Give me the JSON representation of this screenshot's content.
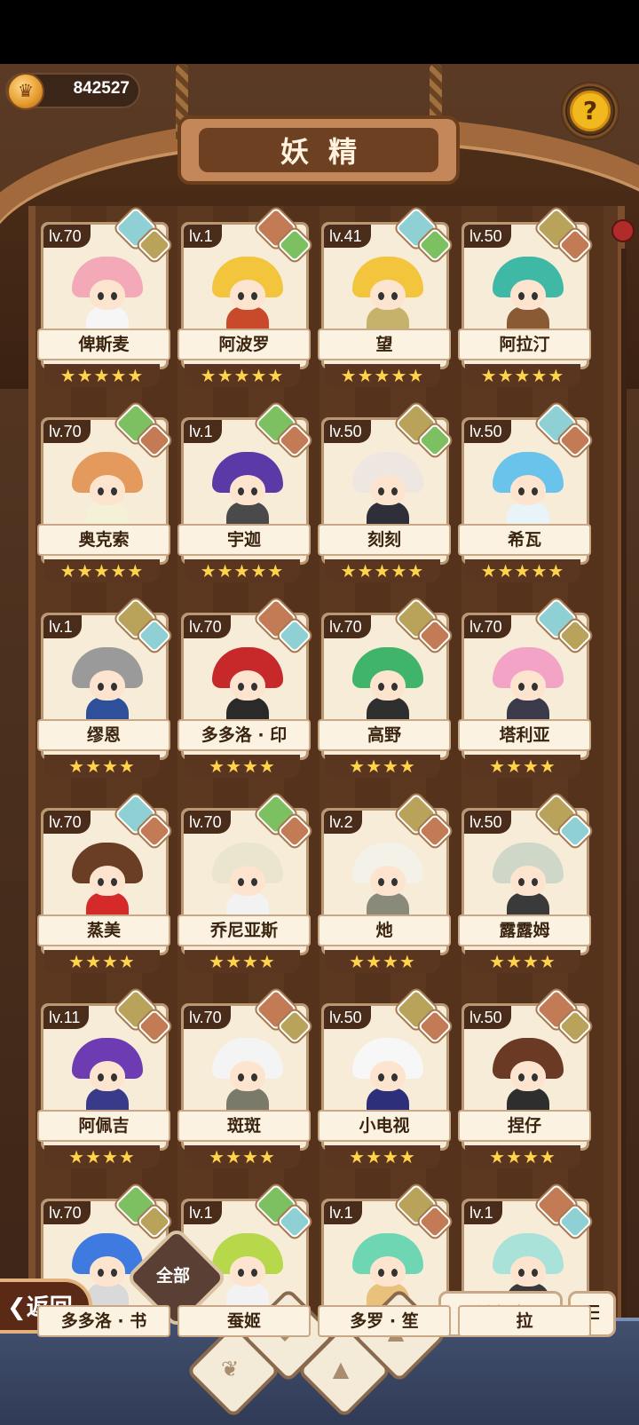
{
  "currency": {
    "icon": "crown-coin-icon",
    "value": "842527"
  },
  "help": {
    "icon": "question-bulb-icon",
    "label": "?"
  },
  "title": "妖精",
  "fairies": [
    {
      "level": "lv.70",
      "name": "俾斯麦",
      "stars": "★★★★★",
      "badges": [
        "water",
        "earth"
      ],
      "hair": "#f3a9b8",
      "outfit": "#f6f6f6"
    },
    {
      "level": "lv.1",
      "name": "阿波罗",
      "stars": "★★★★★",
      "badges": [
        "rock",
        "plant"
      ],
      "hair": "#f2c53d",
      "outfit": "#c94a2a"
    },
    {
      "level": "lv.41",
      "name": "望",
      "stars": "★★★★★",
      "badges": [
        "water",
        "plant"
      ],
      "hair": "#f2c53d",
      "outfit": "#c6b26a"
    },
    {
      "level": "lv.50",
      "name": "阿拉汀",
      "stars": "★★★★★",
      "badges": [
        "earth",
        "rock"
      ],
      "hair": "#3fb8a6",
      "outfit": "#8a5a34"
    },
    {
      "level": "lv.70",
      "name": "奥克索",
      "stars": "★★★★★",
      "badges": [
        "plant",
        "rock"
      ],
      "hair": "#e39a5c",
      "outfit": "#f4f1d8"
    },
    {
      "level": "lv.1",
      "name": "宇迦",
      "stars": "★★★★★",
      "badges": [
        "plant",
        "rock"
      ],
      "hair": "#5b3aa8",
      "outfit": "#4a4a4a"
    },
    {
      "level": "lv.50",
      "name": "刻刻",
      "stars": "★★★★★",
      "badges": [
        "earth",
        "plant"
      ],
      "hair": "#eee6e0",
      "outfit": "#2f2f3a"
    },
    {
      "level": "lv.50",
      "name": "希瓦",
      "stars": "★★★★★",
      "badges": [
        "water",
        "rock"
      ],
      "hair": "#69c3ea",
      "outfit": "#e8f4f8"
    },
    {
      "level": "lv.1",
      "name": "缪恩",
      "stars": "★★★★",
      "badges": [
        "earth",
        "water"
      ],
      "hair": "#9a9a9a",
      "outfit": "#2e4f9a"
    },
    {
      "level": "lv.70",
      "name": "多多洛 · 印",
      "stars": "★★★★",
      "badges": [
        "rock",
        "water"
      ],
      "hair": "#c7282a",
      "outfit": "#2a2a2a"
    },
    {
      "level": "lv.70",
      "name": "高野",
      "stars": "★★★★",
      "badges": [
        "earth",
        "rock"
      ],
      "hair": "#3fb46a",
      "outfit": "#2f2f2f"
    },
    {
      "level": "lv.70",
      "name": "塔利亚",
      "stars": "★★★★",
      "badges": [
        "water",
        "earth"
      ],
      "hair": "#f3a3c6",
      "outfit": "#3a3a4a"
    },
    {
      "level": "lv.70",
      "name": "蒸美",
      "stars": "★★★★",
      "badges": [
        "water",
        "rock"
      ],
      "hair": "#6a3e24",
      "outfit": "#d42a2a"
    },
    {
      "level": "lv.70",
      "name": "乔尼亚斯",
      "stars": "★★★★",
      "badges": [
        "plant",
        "rock"
      ],
      "hair": "#e9e5cf",
      "outfit": "#f2f2f2"
    },
    {
      "level": "lv.2",
      "name": "灺",
      "stars": "★★★★",
      "badges": [
        "earth",
        "rock"
      ],
      "hair": "#f3f1e8",
      "outfit": "#8a8a7a"
    },
    {
      "level": "lv.50",
      "name": "露露姆",
      "stars": "★★★★",
      "badges": [
        "earth",
        "water"
      ],
      "hair": "#cfd7c8",
      "outfit": "#3a3a3a"
    },
    {
      "level": "lv.11",
      "name": "阿佩吉",
      "stars": "★★★★",
      "badges": [
        "earth",
        "rock"
      ],
      "hair": "#6d3cb3",
      "outfit": "#3a3a8a"
    },
    {
      "level": "lv.70",
      "name": "斑斑",
      "stars": "★★★★",
      "badges": [
        "rock",
        "earth"
      ],
      "hair": "#f4f4f4",
      "outfit": "#7a7a6a"
    },
    {
      "level": "lv.50",
      "name": "小电视",
      "stars": "★★★★",
      "badges": [
        "earth",
        "rock"
      ],
      "hair": "#f7f7f7",
      "outfit": "#2e2f7a"
    },
    {
      "level": "lv.50",
      "name": "捏仔",
      "stars": "★★★★",
      "badges": [
        "rock",
        "earth"
      ],
      "hair": "#6a3a24",
      "outfit": "#2e2e2e"
    },
    {
      "level": "lv.70",
      "name": "多多洛 · 书",
      "stars": "",
      "badges": [
        "plant",
        "earth"
      ],
      "hair": "#3f7ae0",
      "outfit": "#d9d9d9"
    },
    {
      "level": "lv.1",
      "name": "蚕姬",
      "stars": "",
      "badges": [
        "plant",
        "water"
      ],
      "hair": "#b7d84a",
      "outfit": "#f2f2f2"
    },
    {
      "level": "lv.1",
      "name": "多罗 · 笙",
      "stars": "",
      "badges": [
        "earth",
        "rock"
      ],
      "hair": "#6fd6b4",
      "outfit": "#e8c27a"
    },
    {
      "level": "lv.1",
      "name": "拉",
      "stars": "",
      "badges": [
        "rock",
        "water"
      ],
      "hair": "#a9e2d8",
      "outfit": "#3a3a3a"
    }
  ],
  "bottom": {
    "back_label": "返回",
    "back_icon": "chevron-left-icon",
    "filter_all_label": "全部",
    "filter_icons": [
      "water-filter-icon",
      "plant-filter-icon",
      "rock-filter-icon",
      "earth-filter-icon",
      "mountain-filter-icon"
    ],
    "rarity_label": "稀有度",
    "sort_icon": "sort-list-icon"
  }
}
